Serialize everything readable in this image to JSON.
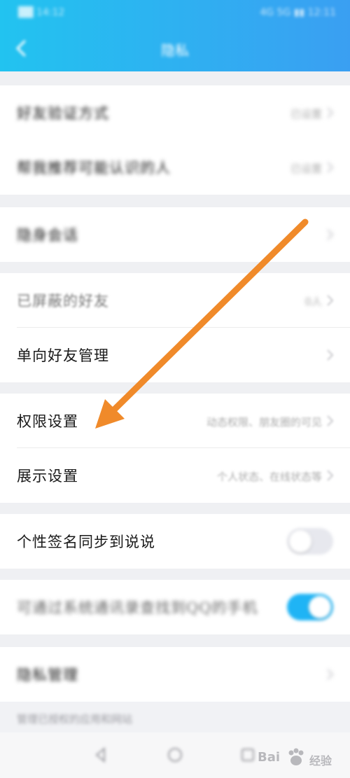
{
  "status_bar": {
    "left_text": "██ 14:12",
    "right_text": "4G 5G ▮▮ 12:11"
  },
  "header": {
    "title": "隐私",
    "back_icon": "back-arrow-icon"
  },
  "sections": {
    "group1": [
      {
        "label": "好友验证方式",
        "value": "已设置"
      },
      {
        "label": "帮我推荐可能认识的人",
        "value": "已设置"
      }
    ],
    "group2": [
      {
        "label": "隐身会话"
      }
    ],
    "group3": [
      {
        "label": "已屏蔽的好友",
        "value": "0人"
      },
      {
        "label": "单向好友管理"
      }
    ],
    "group4": [
      {
        "label": "权限设置",
        "value": "动态权限、朋友圈的可见"
      },
      {
        "label": "展示设置",
        "value": "个人状态、在线状态等"
      }
    ],
    "group5": [
      {
        "label": "个性签名同步到说说",
        "toggle": "off"
      }
    ],
    "group6": [
      {
        "label": "可通过系统通讯录查找到QQ的手机",
        "toggle": "on"
      }
    ],
    "group7": [
      {
        "label": "隐私管理"
      }
    ]
  },
  "footnote": "管理已授权的应用和网站",
  "watermark": {
    "brand": "Bai",
    "suffix": "经验"
  },
  "colors": {
    "header_start": "#22c3f0",
    "header_end": "#3a9ff2",
    "toggle_on": "#1fb4f5",
    "annotation_arrow": "#f08a2a"
  }
}
